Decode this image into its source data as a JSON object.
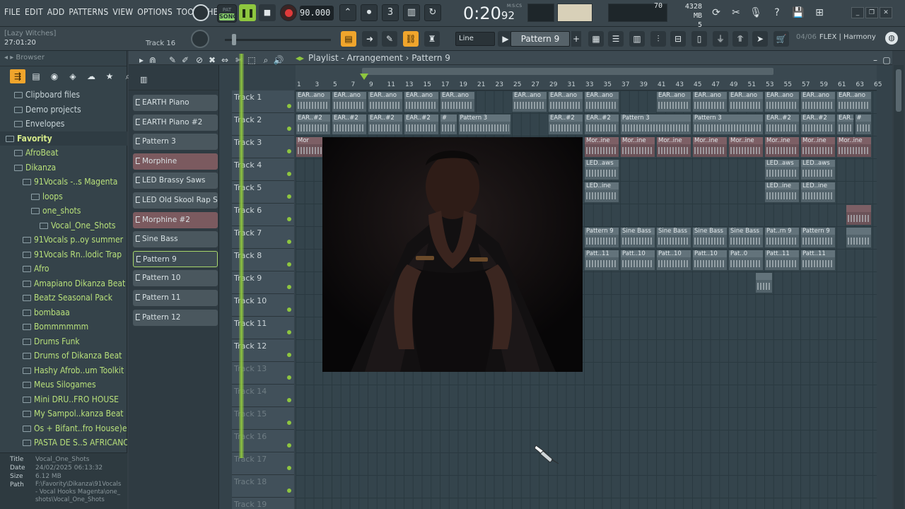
{
  "menu": [
    "FILE",
    "EDIT",
    "ADD",
    "PATTERNS",
    "VIEW",
    "OPTIONS",
    "TOOLS",
    "HELP"
  ],
  "transport": {
    "pat_label": "PAT",
    "song_label": "SONG",
    "tempo": "90.000",
    "time": "0:20",
    "time_ms": "92",
    "time_unit": "M:S:CS",
    "cpu": "70",
    "memory": "4328 MB",
    "voices": "5"
  },
  "hint": {
    "title": "[Lazy Witches]",
    "time": "27:01:20",
    "track": "Track 16"
  },
  "toolbar": {
    "snap": "Line",
    "pattern": "Pattern 9",
    "panel_page": "04/06",
    "panel_text": "FLEX | Harmony"
  },
  "browser": {
    "title": "Browser",
    "items": [
      {
        "label": "Clipboard files",
        "type": "folder",
        "indent": 1
      },
      {
        "label": "Demo projects",
        "type": "folder",
        "indent": 1
      },
      {
        "label": "Envelopes",
        "type": "folder",
        "indent": 1
      },
      {
        "label": "Favority",
        "type": "fav",
        "indent": 0
      },
      {
        "label": "AfroBeat",
        "type": "green",
        "indent": 1
      },
      {
        "label": "Dikanza",
        "type": "green",
        "indent": 1
      },
      {
        "label": "91Vocals -..s Magenta",
        "type": "green",
        "indent": 2
      },
      {
        "label": "loops",
        "type": "green",
        "indent": 3
      },
      {
        "label": "one_shots",
        "type": "green",
        "indent": 3
      },
      {
        "label": "Vocal_One_Shots",
        "type": "green",
        "indent": 4
      },
      {
        "label": "91Vocals p..oy summer",
        "type": "green",
        "indent": 2
      },
      {
        "label": "91Vocals Rn..lodic Trap",
        "type": "green",
        "indent": 2
      },
      {
        "label": "Afro",
        "type": "green",
        "indent": 2
      },
      {
        "label": "Amapiano Dikanza Beat",
        "type": "green",
        "indent": 2
      },
      {
        "label": "Beatz Seasonal Pack",
        "type": "green",
        "indent": 2
      },
      {
        "label": "bombaaa",
        "type": "green",
        "indent": 2
      },
      {
        "label": "Bommmmmm",
        "type": "green",
        "indent": 2
      },
      {
        "label": "Drums Funk",
        "type": "green",
        "indent": 2
      },
      {
        "label": "Drums of Dikanza Beat",
        "type": "green",
        "indent": 2
      },
      {
        "label": "Hashy Afrob..um Toolkit",
        "type": "green",
        "indent": 2
      },
      {
        "label": "Meus Silogames",
        "type": "green",
        "indent": 2
      },
      {
        "label": "Mini DRU..FRO HOUSE",
        "type": "green",
        "indent": 2
      },
      {
        "label": "My Sampol..kanza Beat",
        "type": "green",
        "indent": 2
      },
      {
        "label": "Os + Bifant..fro House)e",
        "type": "green",
        "indent": 2
      },
      {
        "label": "PASTA DE S..S AFRICANO",
        "type": "green",
        "indent": 2
      }
    ],
    "meta": {
      "title_k": "Title",
      "title_v": "Vocal_One_Shots",
      "date_k": "Date",
      "date_v": "24/02/2025 06:13:32",
      "size_k": "Size",
      "size_v": "6.12 MB",
      "path_k": "Path",
      "path_v": "F:\\Favority\\Dikanza\\91Vocals - Vocal Hooks Magenta\\one_shots\\Vocal_One_Shots"
    }
  },
  "playlist": {
    "title": "Playlist - Arrangement",
    "pattern": "Pattern 9",
    "clips": [
      {
        "label": "EARTH Piano",
        "style": "grey"
      },
      {
        "label": "EARTH Piano #2",
        "style": "grey"
      },
      {
        "label": "Pattern 3",
        "style": "grey"
      },
      {
        "label": "Morphine",
        "style": "red"
      },
      {
        "label": "LED Brassy Saws",
        "style": "grey"
      },
      {
        "label": "LED Old Skool Rap Sine",
        "style": "grey"
      },
      {
        "label": "Morphine #2",
        "style": "red"
      },
      {
        "label": "Sine Bass",
        "style": "grey"
      },
      {
        "label": "Pattern 9",
        "style": "sel"
      },
      {
        "label": "Pattern 10",
        "style": "grey"
      },
      {
        "label": "Pattern 11",
        "style": "grey"
      },
      {
        "label": "Pattern 12",
        "style": "grey"
      }
    ],
    "tracks": [
      "Track 1",
      "Track 2",
      "Track 3",
      "Track 4",
      "Track 5",
      "Track 6",
      "Track 7",
      "Track 8",
      "Track 9",
      "Track 10",
      "Track 11",
      "Track 12",
      "Track 13",
      "Track 14",
      "Track 15",
      "Track 16",
      "Track 17",
      "Track 18",
      "Track 19"
    ],
    "ruler": [
      "1",
      "3",
      "5",
      "7",
      "9",
      "11",
      "13",
      "15",
      "17",
      "19",
      "21",
      "23",
      "25",
      "27",
      "29",
      "31",
      "33",
      "35",
      "37",
      "39",
      "41",
      "43",
      "45",
      "47",
      "49",
      "51",
      "53",
      "55",
      "57",
      "59",
      "61",
      "63",
      "65"
    ],
    "blocks": [
      {
        "row": 0,
        "bars": [
          [
            1,
            4,
            "EAR..ano"
          ],
          [
            5,
            8,
            "EAR..ano"
          ],
          [
            9,
            12,
            "EAR..ano"
          ],
          [
            13,
            16,
            "EAR..ano"
          ],
          [
            17,
            20,
            "EAR..ano"
          ],
          [
            25,
            28,
            "EAR..ano"
          ],
          [
            29,
            32,
            "EAR..ano"
          ],
          [
            33,
            36,
            "EAR..ano"
          ],
          [
            41,
            44,
            "EAR..ano"
          ],
          [
            45,
            48,
            "EAR..ano"
          ],
          [
            49,
            52,
            "EAR..ano"
          ],
          [
            53,
            56,
            "EAR..ano"
          ],
          [
            57,
            60,
            "EAR..ano"
          ],
          [
            61,
            64,
            "EAR..ano"
          ]
        ]
      },
      {
        "row": 1,
        "bars": [
          [
            1,
            4,
            "EAR..#2"
          ],
          [
            5,
            8,
            "EAR..#2"
          ],
          [
            9,
            12,
            "EAR..#2"
          ],
          [
            13,
            16,
            "EAR..#2"
          ],
          [
            17,
            18,
            "#"
          ],
          [
            19,
            24,
            "Pattern 3"
          ],
          [
            29,
            32,
            "EAR..#2"
          ],
          [
            33,
            36,
            "EAR..#2"
          ],
          [
            37,
            44,
            "Pattern 3"
          ],
          [
            45,
            52,
            "Pattern 3"
          ],
          [
            53,
            56,
            "EAR..#2"
          ],
          [
            57,
            60,
            "EAR..#2"
          ],
          [
            61,
            62,
            "EAR..#2"
          ],
          [
            63,
            64,
            "#"
          ]
        ]
      },
      {
        "row": 2,
        "bars": [
          [
            1,
            4,
            "Mor"
          ],
          [
            33,
            36,
            "Mor..ine"
          ],
          [
            37,
            40,
            "Mor..ine"
          ],
          [
            41,
            44,
            "Mor..ine"
          ],
          [
            45,
            48,
            "Mor..ine"
          ],
          [
            49,
            52,
            "Mor..ine"
          ],
          [
            53,
            56,
            "Mor..ine"
          ],
          [
            57,
            60,
            "Mor..ine"
          ],
          [
            61,
            64,
            "Mor..ine"
          ]
        ],
        "style": "red"
      },
      {
        "row": 3,
        "bars": [
          [
            33,
            36,
            "LED..aws"
          ],
          [
            53,
            56,
            "LED..aws"
          ],
          [
            57,
            60,
            "LED..aws"
          ]
        ]
      },
      {
        "row": 4,
        "bars": [
          [
            33,
            36,
            "LED..ine"
          ],
          [
            53,
            56,
            "LED..ine"
          ],
          [
            57,
            60,
            "LED..ine"
          ]
        ]
      },
      {
        "row": 5,
        "bars": [
          [
            62,
            64,
            ""
          ]
        ],
        "style": "red"
      },
      {
        "row": 6,
        "bars": [
          [
            33,
            36,
            "Pattern 9"
          ],
          [
            37,
            40,
            "Sine Bass"
          ],
          [
            41,
            44,
            "Sine Bass"
          ],
          [
            45,
            48,
            "Sine Bass"
          ],
          [
            49,
            52,
            "Sine Bass"
          ],
          [
            53,
            56,
            "Pat..rn 9"
          ],
          [
            57,
            60,
            "Pattern 9"
          ],
          [
            62,
            64,
            ""
          ]
        ]
      },
      {
        "row": 7,
        "bars": [
          [
            33,
            36,
            "Patt..11"
          ],
          [
            37,
            40,
            "Patt..10"
          ],
          [
            41,
            44,
            "Patt..10"
          ],
          [
            45,
            48,
            "Patt..10"
          ],
          [
            49,
            52,
            "Pat..0"
          ],
          [
            53,
            56,
            "Patt..11"
          ],
          [
            57,
            60,
            "Patt..11"
          ]
        ]
      },
      {
        "row": 8,
        "bars": [
          [
            52,
            53,
            ""
          ]
        ]
      }
    ]
  }
}
